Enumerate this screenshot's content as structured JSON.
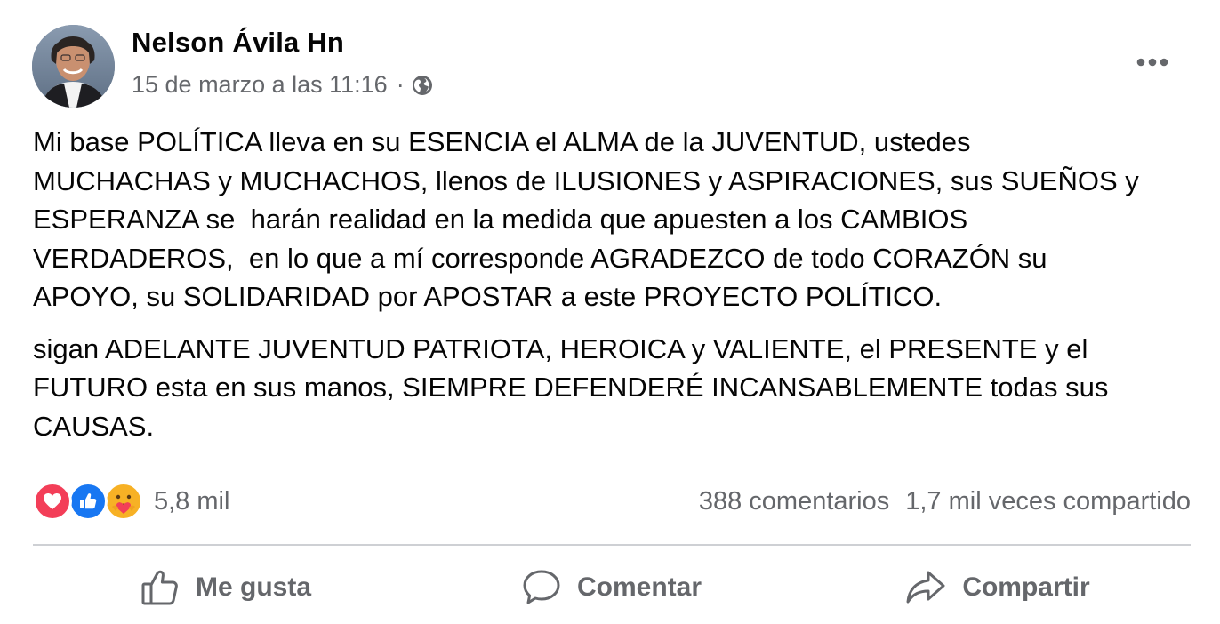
{
  "post": {
    "author": "Nelson Ávila Hn",
    "date": "15 de marzo a las 11:16",
    "separator": "·",
    "audience_icon": "globe-icon",
    "more_icon": "more-horizontal-icon",
    "paragraphs": [
      "Mi base POLÍTICA lleva en su ESENCIA el ALMA de la JUVENTUD, ustedes\nMUCHACHAS y MUCHACHOS, llenos de ILUSIONES y ASPIRACIONES, sus SUEÑOS y\nESPERANZA se  harán realidad en la medida que apuesten a los CAMBIOS\nVERDADEROS,  en lo que a mí corresponde AGRADEZCO de todo CORAZÓN su\nAPOYO, su SOLIDARIDAD por APOSTAR a este PROYECTO POLÍTICO.",
      "sigan ADELANTE JUVENTUD PATRIOTA, HEROICA y VALIENTE, el PRESENTE y el\nFUTURO esta en sus manos, SIEMPRE DEFENDERÉ INCANSABLEMENTE todas sus\nCAUSAS."
    ]
  },
  "stats": {
    "reaction_icons": [
      "love-icon",
      "like-icon",
      "care-icon"
    ],
    "reactions": "5,8 mil",
    "comments": "388 comentarios",
    "shares": "1,7 mil veces compartido"
  },
  "actions": {
    "like": "Me gusta",
    "comment": "Comentar",
    "share": "Compartir"
  },
  "colors": {
    "text": "#050505",
    "secondary": "#65676b",
    "divider": "#ced0d4",
    "like_blue": "#1877f2",
    "love_red": "#f33e58",
    "care_yellow": "#f7b125"
  }
}
